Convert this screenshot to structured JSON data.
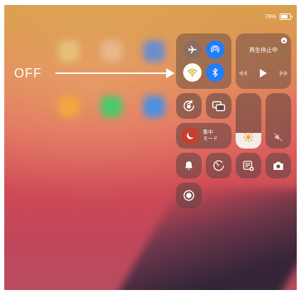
{
  "status_bar": {
    "battery_percent": "78%"
  },
  "annotation": {
    "label": "OFF"
  },
  "connectivity": {
    "airplane_mode": {
      "icon": "airplane-icon",
      "state": "off"
    },
    "airdrop": {
      "icon": "airdrop-icon",
      "state": "on"
    },
    "wifi": {
      "icon": "wifi-icon",
      "state": "off"
    },
    "bluetooth": {
      "icon": "bluetooth-icon",
      "state": "on"
    }
  },
  "media": {
    "status": "再生停止中",
    "airplay_icon": "airplay-icon"
  },
  "focus": {
    "line1": "集中",
    "line2": "モード"
  },
  "brightness": {
    "level": 0.28,
    "icon": "sun-icon"
  },
  "volume": {
    "level": 0,
    "icon": "mute-speaker-icon"
  },
  "colors": {
    "blue": "#1f7ef8",
    "tile": "#6e5046",
    "focus_circle": "#c4402f"
  }
}
